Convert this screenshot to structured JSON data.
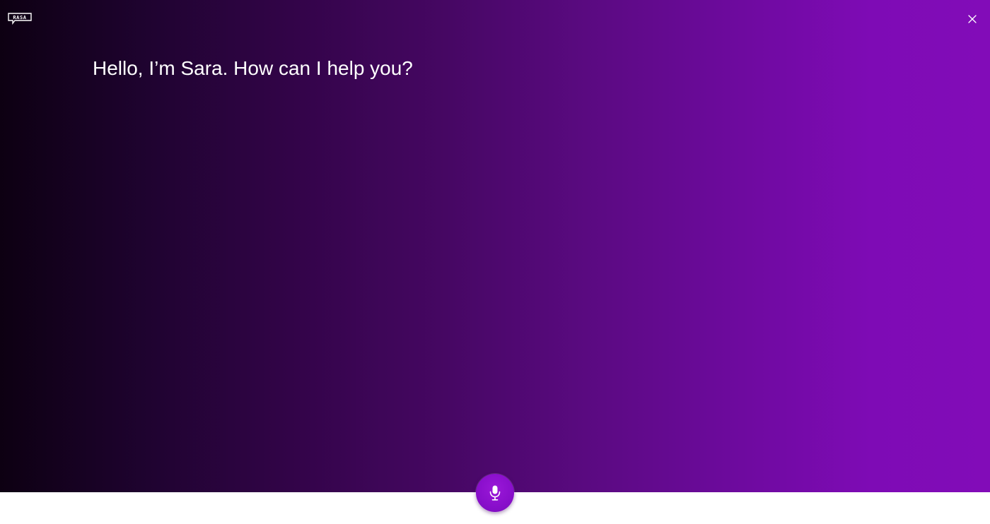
{
  "brand": {
    "logo_text": "RASA"
  },
  "header": {
    "close_icon": "close-icon"
  },
  "main": {
    "greeting": "Hello, I’m Sara. How can I help you?"
  },
  "controls": {
    "mic_icon": "microphone-icon"
  },
  "colors": {
    "gradient_start": "#0d0012",
    "gradient_end": "#820cb8",
    "mic_button": "#8a0fcc",
    "text": "#ffffff",
    "footer": "#ffffff"
  }
}
